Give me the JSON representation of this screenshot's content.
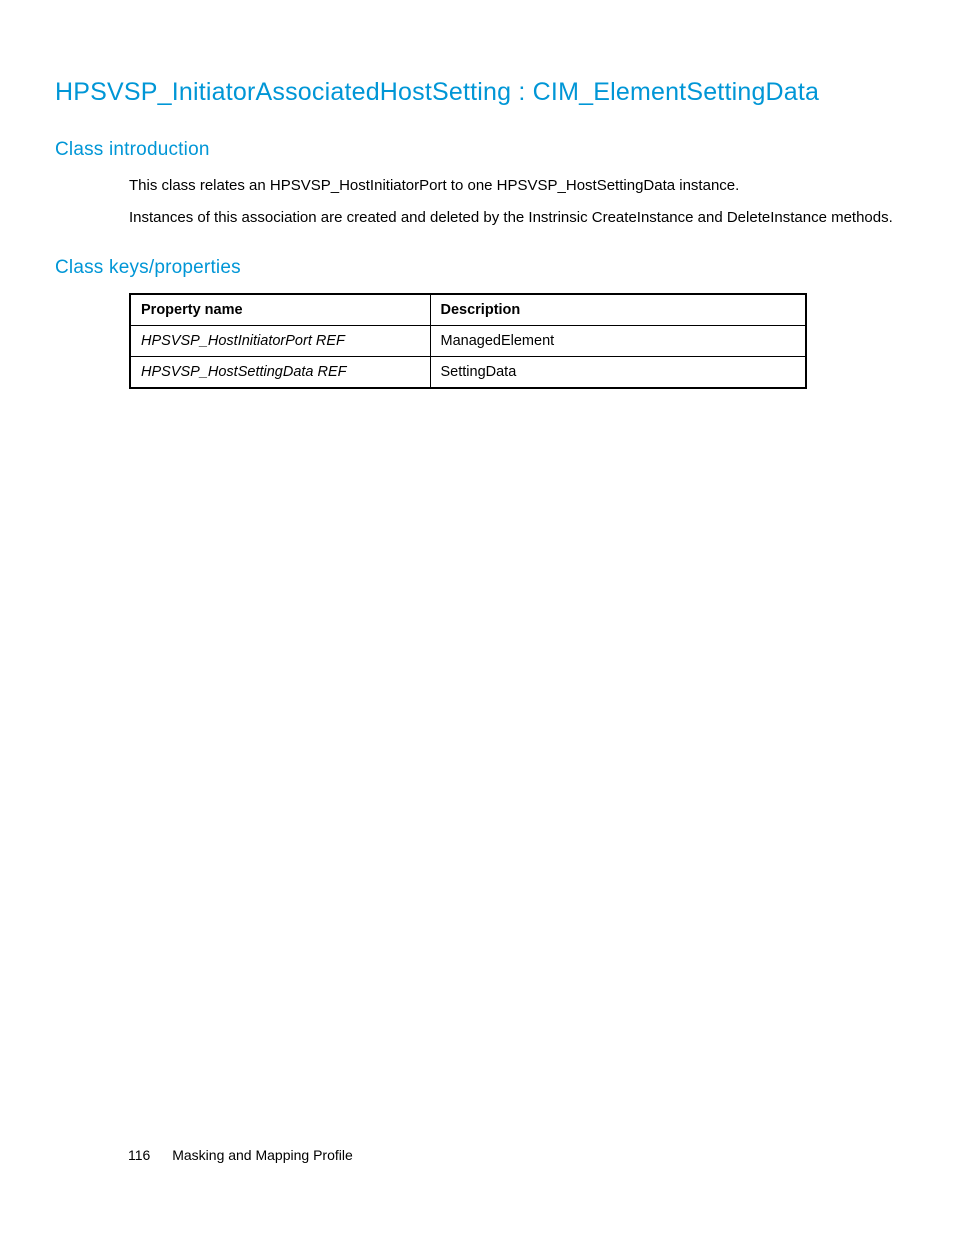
{
  "heading_main": "HPSVSP_InitiatorAssociatedHostSetting : CIM_ElementSettingData",
  "section_intro": {
    "heading": "Class introduction",
    "para1": "This class relates an HPSVSP_HostInitiatorPort to one HPSVSP_HostSettingData instance.",
    "para2": "Instances of this association are created and deleted by the Instrinsic CreateInstance and DeleteInstance methods."
  },
  "section_props": {
    "heading": "Class keys/properties",
    "table": {
      "headers": {
        "col1": "Property name",
        "col2": "Description"
      },
      "rows": [
        {
          "name": "HPSVSP_HostInitiatorPort REF",
          "desc": "ManagedElement"
        },
        {
          "name": "HPSVSP_HostSettingData REF",
          "desc": "SettingData"
        }
      ]
    }
  },
  "footer": {
    "page_number": "116",
    "section_title": "Masking and Mapping Profile"
  }
}
